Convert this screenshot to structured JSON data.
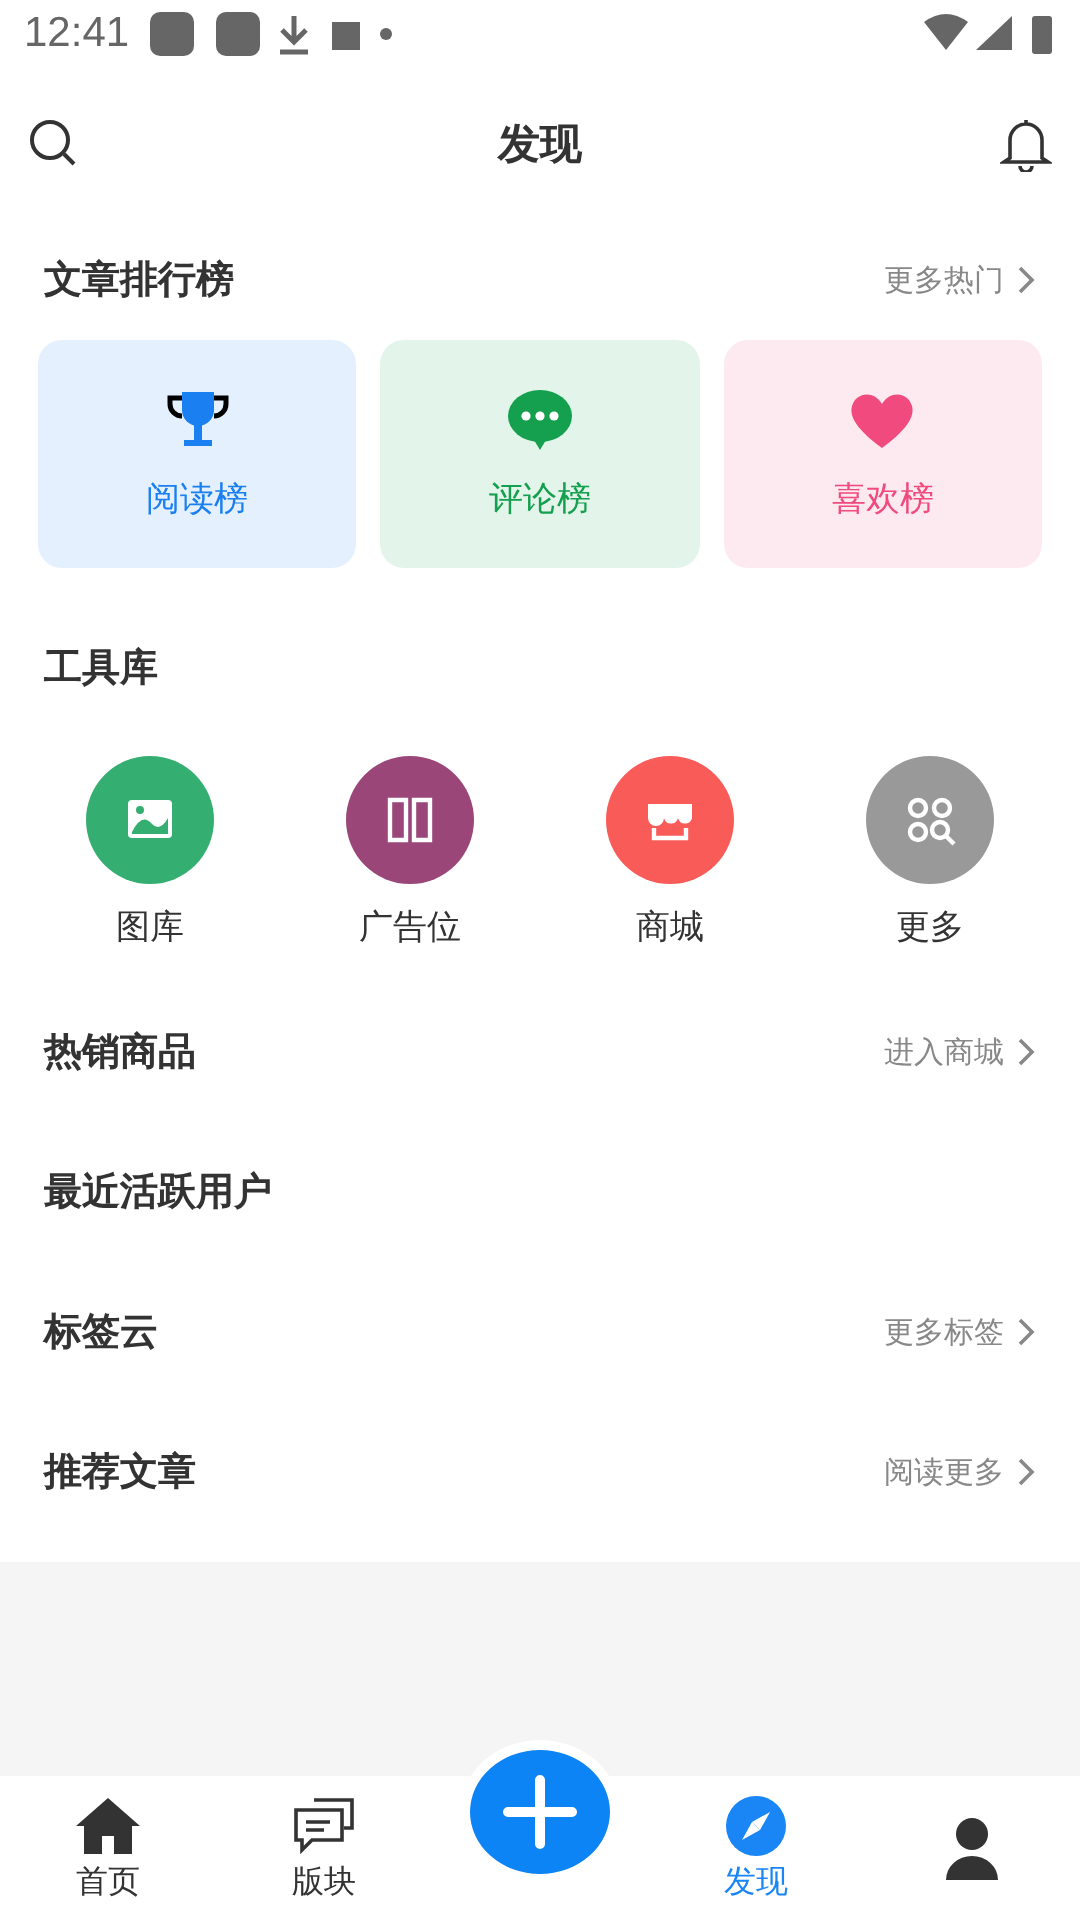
{
  "status_bar": {
    "time": "12:41"
  },
  "header": {
    "title": "发现"
  },
  "ranking": {
    "title": "文章排行榜",
    "more": "更多热门",
    "cards": [
      {
        "label": "阅读榜",
        "color": "#1a7ff0"
      },
      {
        "label": "评论榜",
        "color": "#14a04e"
      },
      {
        "label": "喜欢榜",
        "color": "#f04a7e"
      }
    ]
  },
  "tools": {
    "title": "工具库",
    "items": [
      {
        "label": "图库",
        "color": "#35ae72"
      },
      {
        "label": "广告位",
        "color": "#9a4679"
      },
      {
        "label": "商城",
        "color": "#f85b58"
      },
      {
        "label": "更多",
        "color": "#999999"
      }
    ]
  },
  "sections": [
    {
      "title": "热销商品",
      "more": "进入商城"
    },
    {
      "title": "最近活跃用户"
    },
    {
      "title": "标签云",
      "more": "更多标签"
    },
    {
      "title": "推荐文章",
      "more": "阅读更多"
    }
  ],
  "nav": {
    "items": [
      {
        "kind": "tab",
        "label": "首页",
        "selected": false
      },
      {
        "kind": "tab",
        "label": "版块",
        "selected": false
      },
      {
        "kind": "fab",
        "selected": false
      },
      {
        "kind": "tab",
        "label": "发现",
        "selected": true
      },
      {
        "kind": "tab",
        "selected": false
      }
    ]
  }
}
